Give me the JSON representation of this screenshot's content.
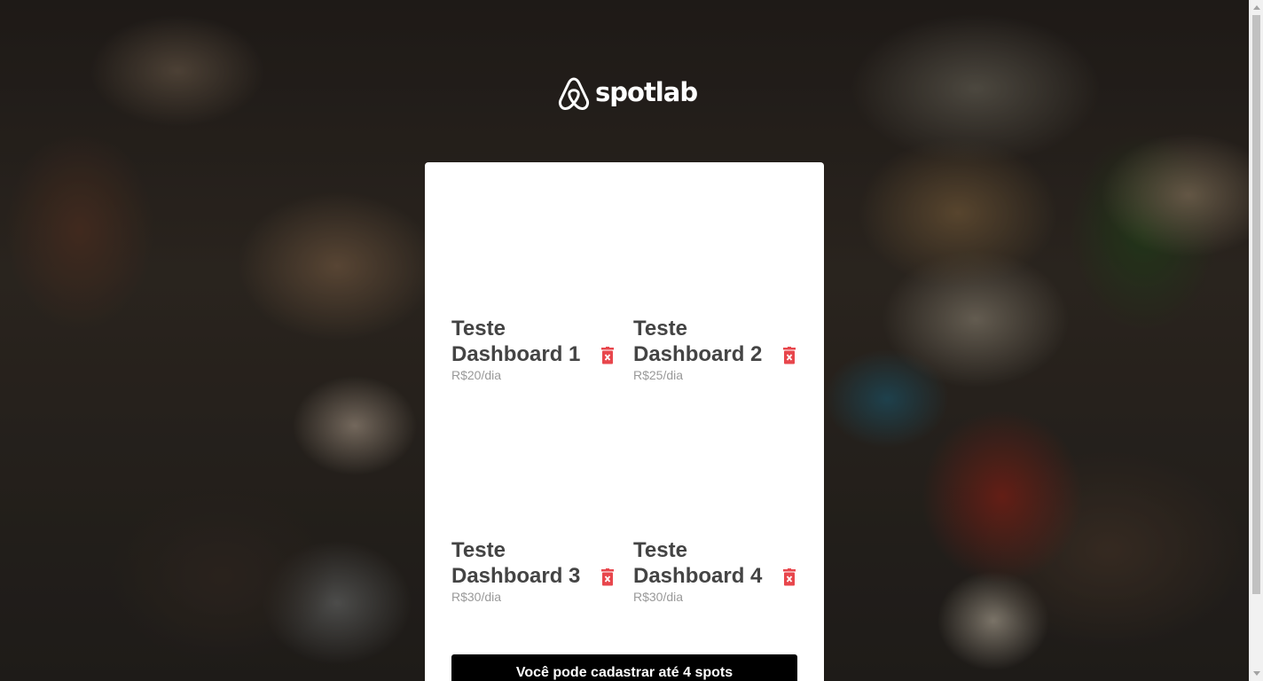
{
  "brand": {
    "name": "spotlab"
  },
  "spots": [
    {
      "title": "Teste Dashboard 1",
      "price": "R$20/dia"
    },
    {
      "title": "Teste Dashboard 2",
      "price": "R$25/dia"
    },
    {
      "title": "Teste Dashboard 3",
      "price": "R$30/dia"
    },
    {
      "title": "Teste Dashboard 4",
      "price": "R$30/dia"
    }
  ],
  "cta": {
    "label": "Você pode cadastrar até 4 spots"
  },
  "colors": {
    "delete": "#e8464c",
    "cta_bg": "#000000",
    "title": "#444444",
    "price": "#999999"
  }
}
